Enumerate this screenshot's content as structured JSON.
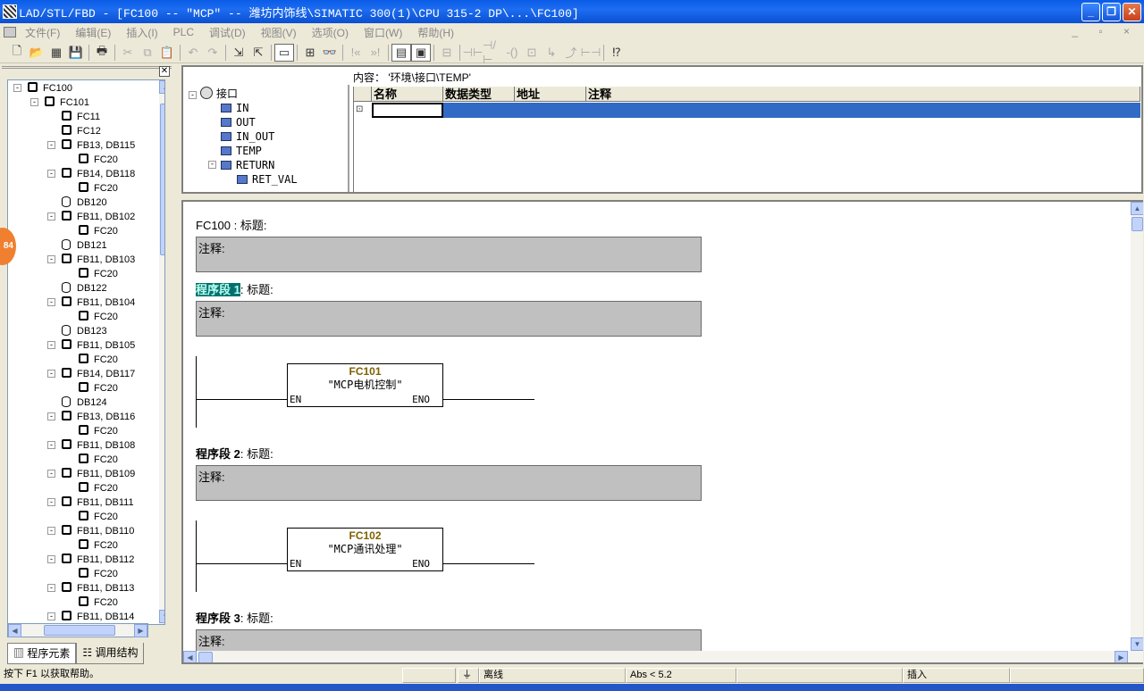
{
  "window": {
    "title": "LAD/STL/FBD  - [FC100 -- \"MCP\" -- 潍坊内饰线\\SIMATIC 300(1)\\CPU 315-2 DP\\...\\FC100]"
  },
  "menu": [
    "文件(F)",
    "编辑(E)",
    "插入(I)",
    "PLC",
    "调试(D)",
    "视图(V)",
    "选项(O)",
    "窗口(W)",
    "帮助(H)"
  ],
  "mdi_controls": "_ ▫ ×",
  "left_panel": {
    "badge": "84",
    "tree": [
      {
        "label": "FC100",
        "level": 0,
        "icon": "block",
        "expand": "-"
      },
      {
        "label": "FC101",
        "level": 1,
        "icon": "block",
        "expand": "-"
      },
      {
        "label": "FC11",
        "level": 2,
        "icon": "block"
      },
      {
        "label": "FC12",
        "level": 2,
        "icon": "block"
      },
      {
        "label": "FB13, DB115",
        "level": 2,
        "icon": "block",
        "expand": "-"
      },
      {
        "label": "FC20",
        "level": 3,
        "icon": "block"
      },
      {
        "label": "FB14, DB118",
        "level": 2,
        "icon": "block",
        "expand": "-"
      },
      {
        "label": "FC20",
        "level": 3,
        "icon": "block"
      },
      {
        "label": "DB120",
        "level": 2,
        "icon": "db"
      },
      {
        "label": "FB11, DB102",
        "level": 2,
        "icon": "block",
        "expand": "-"
      },
      {
        "label": "FC20",
        "level": 3,
        "icon": "block"
      },
      {
        "label": "DB121",
        "level": 2,
        "icon": "db"
      },
      {
        "label": "FB11, DB103",
        "level": 2,
        "icon": "block",
        "expand": "-"
      },
      {
        "label": "FC20",
        "level": 3,
        "icon": "block"
      },
      {
        "label": "DB122",
        "level": 2,
        "icon": "db"
      },
      {
        "label": "FB11, DB104",
        "level": 2,
        "icon": "block",
        "expand": "-"
      },
      {
        "label": "FC20",
        "level": 3,
        "icon": "block"
      },
      {
        "label": "DB123",
        "level": 2,
        "icon": "db"
      },
      {
        "label": "FB11, DB105",
        "level": 2,
        "icon": "block",
        "expand": "-"
      },
      {
        "label": "FC20",
        "level": 3,
        "icon": "block"
      },
      {
        "label": "FB14, DB117",
        "level": 2,
        "icon": "block",
        "expand": "-"
      },
      {
        "label": "FC20",
        "level": 3,
        "icon": "block"
      },
      {
        "label": "DB124",
        "level": 2,
        "icon": "db"
      },
      {
        "label": "FB13, DB116",
        "level": 2,
        "icon": "block",
        "expand": "-"
      },
      {
        "label": "FC20",
        "level": 3,
        "icon": "block"
      },
      {
        "label": "FB11, DB108",
        "level": 2,
        "icon": "block",
        "expand": "-"
      },
      {
        "label": "FC20",
        "level": 3,
        "icon": "block"
      },
      {
        "label": "FB11, DB109",
        "level": 2,
        "icon": "block",
        "expand": "-"
      },
      {
        "label": "FC20",
        "level": 3,
        "icon": "block"
      },
      {
        "label": "FB11, DB111",
        "level": 2,
        "icon": "block",
        "expand": "-"
      },
      {
        "label": "FC20",
        "level": 3,
        "icon": "block"
      },
      {
        "label": "FB11, DB110",
        "level": 2,
        "icon": "block",
        "expand": "-"
      },
      {
        "label": "FC20",
        "level": 3,
        "icon": "block"
      },
      {
        "label": "FB11, DB112",
        "level": 2,
        "icon": "block",
        "expand": "-"
      },
      {
        "label": "FC20",
        "level": 3,
        "icon": "block"
      },
      {
        "label": "FB11, DB113",
        "level": 2,
        "icon": "block",
        "expand": "-"
      },
      {
        "label": "FC20",
        "level": 3,
        "icon": "block"
      },
      {
        "label": "FB11, DB114",
        "level": 2,
        "icon": "block",
        "expand": "-"
      }
    ],
    "tabs": [
      "程序元素",
      "调用结构"
    ]
  },
  "interface": {
    "root": "接口",
    "items": [
      {
        "label": "IN",
        "level": 1
      },
      {
        "label": "OUT",
        "level": 1
      },
      {
        "label": "IN_OUT",
        "level": 1
      },
      {
        "label": "TEMP",
        "level": 1
      },
      {
        "label": "RETURN",
        "level": 1
      },
      {
        "label": "RET_VAL",
        "level": 2
      }
    ],
    "content_label": "内容： '环境\\接口\\TEMP'",
    "columns": [
      "名称",
      "数据类型",
      "地址",
      "注释"
    ]
  },
  "editor": {
    "block_title": "FC100 : 标题:",
    "block_comment": "注释:",
    "networks": [
      {
        "label": "程序段 1",
        "title_suffix": ": 标题:",
        "comment": "注释:",
        "fb_name": "FC101",
        "fb_symbol": "\"MCP电机控制\"",
        "en": "EN",
        "eno": "ENO"
      },
      {
        "label": "程序段 2",
        "title_suffix": ": 标题:",
        "comment": "注释:",
        "fb_name": "FC102",
        "fb_symbol": "\"MCP通讯处理\"",
        "en": "EN",
        "eno": "ENO"
      },
      {
        "label": "程序段 3",
        "title_suffix": ": 标题:",
        "comment": "注释:"
      }
    ]
  },
  "status": {
    "help": "按下 F1 以获取帮助。",
    "online": "离线",
    "position": "Abs < 5.2",
    "mode": "插入"
  }
}
